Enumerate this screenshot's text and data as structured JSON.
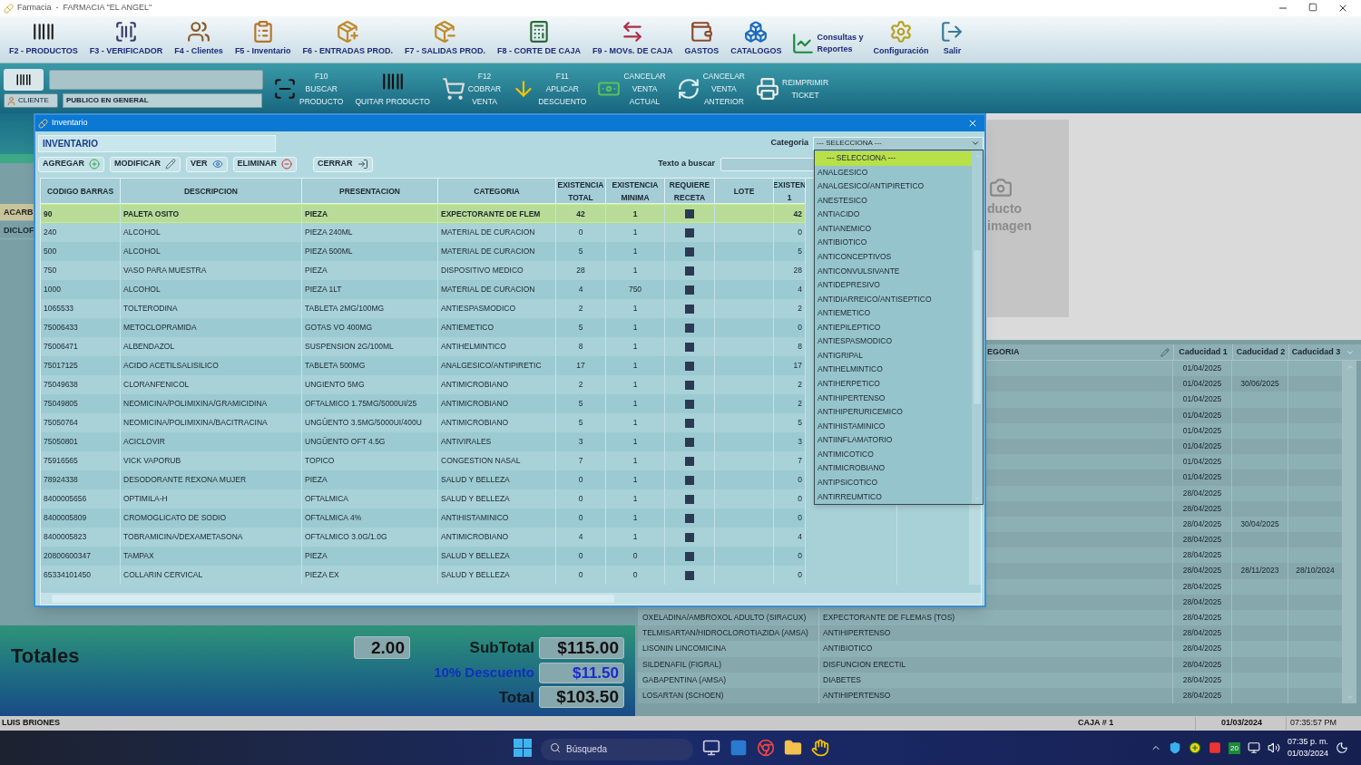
{
  "title_bar": {
    "title": "Farmacia  -  FARMACIA \"EL ANGEL\""
  },
  "main_toolbar": [
    {
      "label": "F2 - PRODUCTOS",
      "kind": "stacked"
    },
    {
      "label": "F3 - VERIFICADOR",
      "kind": "stacked"
    },
    {
      "label": "F4 - Clientes",
      "kind": "stacked"
    },
    {
      "label": "F5 - Inventario",
      "kind": "stacked"
    },
    {
      "label": "F6 - ENTRADAS PROD.",
      "kind": "stacked"
    },
    {
      "label": "F7 - SALIDAS PROD.",
      "kind": "stacked"
    },
    {
      "label": "F8 - CORTE DE CAJA",
      "kind": "stacked"
    },
    {
      "label": "F9 - MOVs. DE CAJA",
      "kind": "stacked"
    },
    {
      "label": "GASTOS",
      "kind": "stacked"
    },
    {
      "label": "CATALOGOS",
      "kind": "stacked"
    },
    {
      "label": "Consultas y\nReportes",
      "kind": "side"
    },
    {
      "label": "Configuración",
      "kind": "stacked"
    },
    {
      "label": "Salir",
      "kind": "stacked"
    }
  ],
  "sale_toolbar": {
    "client_button": "CLIENTE",
    "client_name": "PUBLICO EN GENERAL",
    "actions": [
      {
        "label": "F10\nBUSCAR\nPRODUCTO",
        "kind": "side"
      },
      {
        "label": "QUITAR PRODUCTO",
        "kind": "stacked"
      },
      {
        "label": "F12\nCOBRAR\nVENTA",
        "kind": "side"
      },
      {
        "label": "F11\nAPLICAR\nDESCUENTO",
        "kind": "side"
      },
      {
        "label": "CANCELAR\nVENTA\nACTUAL",
        "kind": "side"
      },
      {
        "label": "CANCELAR\nVENTA\nANTERIOR",
        "kind": "side"
      },
      {
        "label": "REIMPRIMIR\nTICKET",
        "kind": "side"
      }
    ]
  },
  "sales_table": {
    "rows": [
      {
        "text": "ACARB",
        "selected": true
      },
      {
        "text": "DICLOF",
        "selected": false
      }
    ]
  },
  "product_image": {
    "lines": [
      "ducto",
      "imagen"
    ]
  },
  "expiry_table": {
    "columns": [
      "EGORIA",
      "Caducidad 1",
      "Caducidad 2",
      "Caducidad 3"
    ],
    "rows": [
      {
        "caducidad_1": "01/04/2025"
      },
      {
        "caducidad_1": "01/04/2025",
        "caducidad_2": "30/06/2025"
      },
      {
        "caducidad_1": "01/04/2025"
      },
      {
        "caducidad_1": "01/04/2025"
      },
      {
        "caducidad_1": "01/04/2025"
      },
      {
        "caducidad_1": "01/04/2025"
      },
      {
        "caducidad_1": "01/04/2025"
      },
      {
        "caducidad_1": "01/04/2025"
      },
      {
        "caducidad_1": "28/04/2025"
      },
      {
        "caducidad_1": "28/04/2025"
      },
      {
        "caducidad_1": "28/04/2025",
        "caducidad_2": "30/04/2025"
      },
      {
        "caducidad_1": "28/04/2025"
      },
      {
        "caducidad_1": "28/04/2025"
      },
      {
        "caducidad_1": "28/04/2025",
        "caducidad_2": "28/11/2023",
        "caducidad_3": "28/10/2024"
      },
      {
        "caducidad_1": "28/04/2025"
      },
      {
        "caducidad_1": "28/04/2025"
      },
      {
        "description": "OXELADINA/AMBROXOL ADULTO (SIRACUX)",
        "category": "EXPECTORANTE DE FLEMAS (TOS)",
        "caducidad_1": "28/04/2025"
      },
      {
        "description": "TELMISARTAN/HIDROCLOROTIAZIDA (AMSA)",
        "category": "ANTIHIPERTENSO",
        "caducidad_1": "28/04/2025"
      },
      {
        "description": "LISONIN LINCOMICINA",
        "category": "ANTIBIOTICO",
        "caducidad_1": "28/04/2025"
      },
      {
        "description": "SILDENAFIL (FIGRAL)",
        "category": "DISFUNCION ERECTIL",
        "caducidad_1": "28/04/2025"
      },
      {
        "description": "GABAPENTINA (AMSA)",
        "category": "DIABETES",
        "caducidad_1": "28/04/2025"
      },
      {
        "description": "LOSARTAN (SCHOEN)",
        "category": "ANTIHIPERTENSO",
        "caducidad_1": "28/04/2025"
      }
    ]
  },
  "totals": {
    "title": "Totales",
    "quantity": "2.00",
    "subtotal_label": "SubTotal",
    "subtotal": "$115.00",
    "discount_label": "10% Descuento",
    "discount": "$11.50",
    "total_label": "Total",
    "total": "$103.50"
  },
  "status_bar": {
    "user": "LUIS BRIONES",
    "register": "CAJA # 1",
    "date": "01/03/2024",
    "time": "07:35:57 PM"
  },
  "taskbar": {
    "search": {
      "placeholder": "Búsqueda"
    },
    "tray_badge": "20",
    "clock_time": "07:35 p. m.",
    "clock_date": "01/03/2024"
  },
  "inventory_dialog": {
    "title": "Inventario",
    "tab": "INVENTARIO",
    "buttons": [
      {
        "label": "AGREGAR",
        "kind": "add"
      },
      {
        "label": "MODIFICAR",
        "kind": "edit"
      },
      {
        "label": "VER",
        "kind": "view"
      },
      {
        "label": "ELIMINAR",
        "kind": "delete"
      },
      {
        "label": "CERRAR",
        "kind": "close"
      }
    ],
    "category_label": "Categoria",
    "category_value": "--- SELECCIONA ---",
    "search_label": "Texto a buscar",
    "columns": [
      "CODIGO BARRAS",
      "DESCRIPCION",
      "PRESENTACION",
      "CATEGORIA",
      "EXISTENCIA\nTOTAL",
      "EXISTENCIA\nMINIMA",
      "REQUIERE\nRECETA",
      "LOTE",
      "EXISTEN\n1"
    ],
    "rows": [
      {
        "code": "90",
        "description": "PALETA OSITO",
        "presentation": "PIEZA",
        "category": "EXPECTORANTE DE FLEM",
        "total": "42",
        "minimum": "1",
        "prescription": true,
        "stock_1": "42",
        "selected": true
      },
      {
        "code": "240",
        "description": "ALCOHOL",
        "presentation": "PIEZA 240ML",
        "category": "MATERIAL DE CURACION",
        "total": "0",
        "minimum": "1",
        "prescription": true,
        "stock_1": "0",
        "selected": false
      },
      {
        "code": "500",
        "description": "ALCOHOL",
        "presentation": "PIEZA 500ML",
        "category": "MATERIAL DE CURACION",
        "total": "5",
        "minimum": "1",
        "prescription": true,
        "stock_1": "5",
        "selected": false
      },
      {
        "code": "750",
        "description": "VASO PARA MUESTRA",
        "presentation": "PIEZA",
        "category": "DISPOSITIVO MEDICO",
        "total": "28",
        "minimum": "1",
        "prescription": true,
        "stock_1": "28",
        "selected": false
      },
      {
        "code": "1000",
        "description": "ALCOHOL",
        "presentation": "PIEZA 1LT",
        "category": "MATERIAL DE CURACION",
        "total": "4",
        "minimum": "750",
        "prescription": true,
        "stock_1": "4",
        "selected": false
      },
      {
        "code": "1065533",
        "description": "TOLTERODINA",
        "presentation": "TABLETA 2MG/100MG",
        "category": "ANTIESPASMODICO",
        "total": "2",
        "minimum": "1",
        "prescription": true,
        "stock_1": "2",
        "selected": false
      },
      {
        "code": "75006433",
        "description": "METOCLOPRAMIDA",
        "presentation": "GOTAS VO 400MG",
        "category": "ANTIEMETICO",
        "total": "5",
        "minimum": "1",
        "prescription": true,
        "stock_1": "0",
        "selected": false
      },
      {
        "code": "75006471",
        "description": "ALBENDAZOL",
        "presentation": "SUSPENSION 2G/100ML",
        "category": "ANTIHELMINTICO",
        "total": "8",
        "minimum": "1",
        "prescription": true,
        "stock_1": "8",
        "selected": false
      },
      {
        "code": "75017125",
        "description": "ACIDO ACETILSALISILICO",
        "presentation": "TABLETA  500MG",
        "category": "ANALGESICO/ANTIPIRETIC",
        "total": "17",
        "minimum": "1",
        "prescription": true,
        "stock_1": "17",
        "selected": false
      },
      {
        "code": "75049638",
        "description": "CLORANFENICOL",
        "presentation": "UNGIENTO 5MG",
        "category": "ANTIMICROBIANO",
        "total": "2",
        "minimum": "1",
        "prescription": true,
        "stock_1": "2",
        "selected": false
      },
      {
        "code": "75049805",
        "description": "NEOMICINA/POLIMIXINA/GRAMICIDINA",
        "presentation": "OFTALMICO 1.75MG/5000UI/25",
        "category": "ANTIMICROBIANO",
        "total": "5",
        "minimum": "1",
        "prescription": true,
        "stock_1": "2",
        "selected": false
      },
      {
        "code": "75050764",
        "description": "NEOMICINA/POLIMIXINA/BACITRACINA",
        "presentation": "UNGÜENTO 3.5MG/5000UI/400U",
        "category": "ANTIMICROBIANO",
        "total": "5",
        "minimum": "1",
        "prescription": true,
        "stock_1": "5",
        "selected": false
      },
      {
        "code": "75050801",
        "description": "ACICLOVIR",
        "presentation": "UNGÜENTO OFT 4.5G",
        "category": "ANTIVIRALES",
        "total": "3",
        "minimum": "1",
        "prescription": true,
        "stock_1": "3",
        "selected": false
      },
      {
        "code": "75916565",
        "description": "VICK VAPORUB",
        "presentation": "TOPICO",
        "category": "CONGESTION NASAL",
        "total": "7",
        "minimum": "1",
        "prescription": true,
        "stock_1": "7",
        "selected": false
      },
      {
        "code": "78924338",
        "description": "DESODORANTE REXONA MUJER",
        "presentation": "PIEZA",
        "category": "SALUD Y BELLEZA",
        "total": "0",
        "minimum": "1",
        "prescription": true,
        "stock_1": "0",
        "selected": false
      },
      {
        "code": "8400005656",
        "description": "OPTIMILA-H",
        "presentation": "OFTALMICA",
        "category": "SALUD Y BELLEZA",
        "total": "0",
        "minimum": "1",
        "prescription": true,
        "stock_1": "0",
        "selected": false
      },
      {
        "code": "8400005809",
        "description": "CROMOGLICATO DE SODIO",
        "presentation": "OFTALMICA 4%",
        "category": "ANTIHISTAMINICO",
        "total": "0",
        "minimum": "1",
        "prescription": true,
        "stock_1": "0",
        "selected": false
      },
      {
        "code": "8400005823",
        "description": "TOBRAMICINA/DEXAMETASONA",
        "presentation": "OFTALMICO 3.0G/1.0G",
        "category": "ANTIMICROBIANO",
        "total": "4",
        "minimum": "1",
        "prescription": true,
        "stock_1": "4",
        "selected": false
      },
      {
        "code": "20800600347",
        "description": "TAMPAX",
        "presentation": "PIEZA",
        "category": "SALUD Y BELLEZA",
        "total": "0",
        "minimum": "0",
        "prescription": true,
        "stock_1": "0",
        "selected": false
      },
      {
        "code": "65334101450",
        "description": "COLLARIN CERVICAL",
        "presentation": "PIEZA EX",
        "category": "SALUD Y BELLEZA",
        "total": "0",
        "minimum": "0",
        "prescription": true,
        "stock_1": "0",
        "selected": false
      }
    ],
    "category_options": [
      {
        "label": "--- SELECCIONA ---",
        "selected": true
      },
      {
        "label": "ANALGESICO",
        "selected": false
      },
      {
        "label": "ANALGESICO/ANTIPIRETICO",
        "selected": false
      },
      {
        "label": "ANESTESICO",
        "selected": false
      },
      {
        "label": "ANTIACIDO",
        "selected": false
      },
      {
        "label": "ANTIANEMICO",
        "selected": false
      },
      {
        "label": "ANTIBIOTICO",
        "selected": false
      },
      {
        "label": "ANTICONCEPTIVOS",
        "selected": false
      },
      {
        "label": "ANTICONVULSIVANTE",
        "selected": false
      },
      {
        "label": "ANTIDEPRESIVO",
        "selected": false
      },
      {
        "label": "ANTIDIARREICO/ANTISEPTICO",
        "selected": false
      },
      {
        "label": "ANTIEMETICO",
        "selected": false
      },
      {
        "label": "ANTIEPILEPTICO",
        "selected": false
      },
      {
        "label": "ANTIESPASMODICO",
        "selected": false
      },
      {
        "label": "ANTIGRIPAL",
        "selected": false
      },
      {
        "label": "ANTIHELMINTICO",
        "selected": false
      },
      {
        "label": "ANTIHERPETICO",
        "selected": false
      },
      {
        "label": "ANTIHIPERTENSO",
        "selected": false
      },
      {
        "label": "ANTIHIPERURICEMICO",
        "selected": false
      },
      {
        "label": "ANTIHISTAMINICO",
        "selected": false
      },
      {
        "label": "ANTIINFLAMATORIO",
        "selected": false
      },
      {
        "label": "ANTIMICOTICO",
        "selected": false
      },
      {
        "label": "ANTIMICROBIANO",
        "selected": false
      },
      {
        "label": "ANTIPSICOTICO",
        "selected": false
      },
      {
        "label": "ANTIRREUMTICO",
        "selected": false
      }
    ]
  }
}
